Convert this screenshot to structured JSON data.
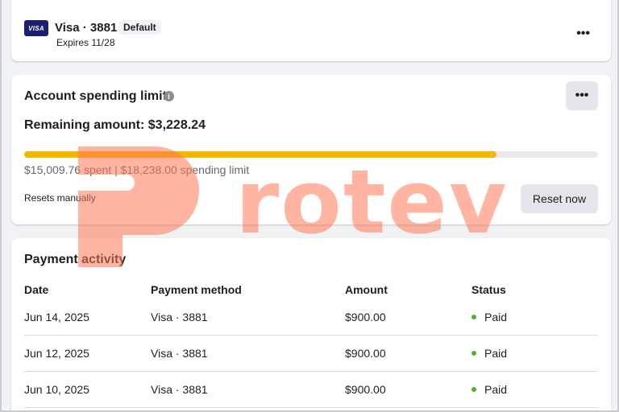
{
  "payment_method": {
    "card_brand": "VISA",
    "title": "Visa · 3881",
    "badge": "Default",
    "expires": "Expires 11/28",
    "more": "•••"
  },
  "spending_limit": {
    "title": "Account spending limit",
    "info_icon": "i",
    "more": "•••",
    "remaining": "Remaining amount: $3,228.24",
    "progress_fraction": 0.823,
    "progress_color": "#f7b500",
    "spent_text": "$15,009.76 spent | $18,238.00 spending limit",
    "resets": "Resets manually",
    "reset_button": "Reset now"
  },
  "activity": {
    "title": "Payment activity",
    "columns": [
      "Date",
      "Payment method",
      "Amount",
      "Status"
    ],
    "rows": [
      {
        "date": "Jun 14, 2025",
        "method": "Visa · 3881",
        "amount": "$900.00",
        "status": "Paid"
      },
      {
        "date": "Jun 12, 2025",
        "method": "Visa · 3881",
        "amount": "$900.00",
        "status": "Paid"
      },
      {
        "date": "Jun 10, 2025",
        "method": "Visa · 3881",
        "amount": "$900.00",
        "status": "Paid"
      }
    ],
    "status_color": "#42b72a"
  },
  "watermark": {
    "text": "rotev",
    "color": "#ff7a55"
  }
}
